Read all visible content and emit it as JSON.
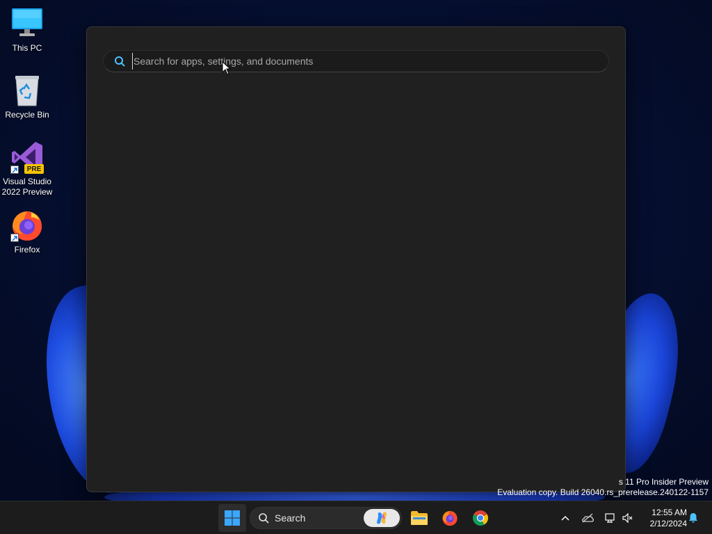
{
  "desktop": {
    "icons": [
      {
        "label": "This PC"
      },
      {
        "label": "Recycle Bin"
      },
      {
        "label_line1": "Visual Studio",
        "label_line2": "2022 Preview",
        "badge": "PRE"
      },
      {
        "label": "Firefox"
      }
    ]
  },
  "search_flyout": {
    "placeholder": "Search for apps, settings, and documents",
    "value": ""
  },
  "watermark": {
    "line1": "s 11 Pro Insider Preview",
    "line2": "Evaluation copy. Build 26040.rs_prerelease.240122-1157"
  },
  "taskbar": {
    "search_label": "Search",
    "pinned": [
      {
        "icon": "windows-start-icon"
      },
      {
        "icon": "file-explorer-icon"
      },
      {
        "icon": "firefox-icon"
      },
      {
        "icon": "chrome-icon"
      }
    ],
    "tray": {
      "icons": [
        "chevron-up-icon",
        "onedrive-icon",
        "network-icon",
        "volume-muted-icon",
        "notification-bell-icon"
      ]
    },
    "clock": {
      "time": "12:55 AM",
      "date": "2/12/2024"
    }
  },
  "colors": {
    "flyout_bg": "#202020",
    "taskbar_bg": "#1c1c1c",
    "accent": "#4cc2ff",
    "wallpaper_dark": "#030a22",
    "wallpaper_bloom": "#1e4de0"
  }
}
